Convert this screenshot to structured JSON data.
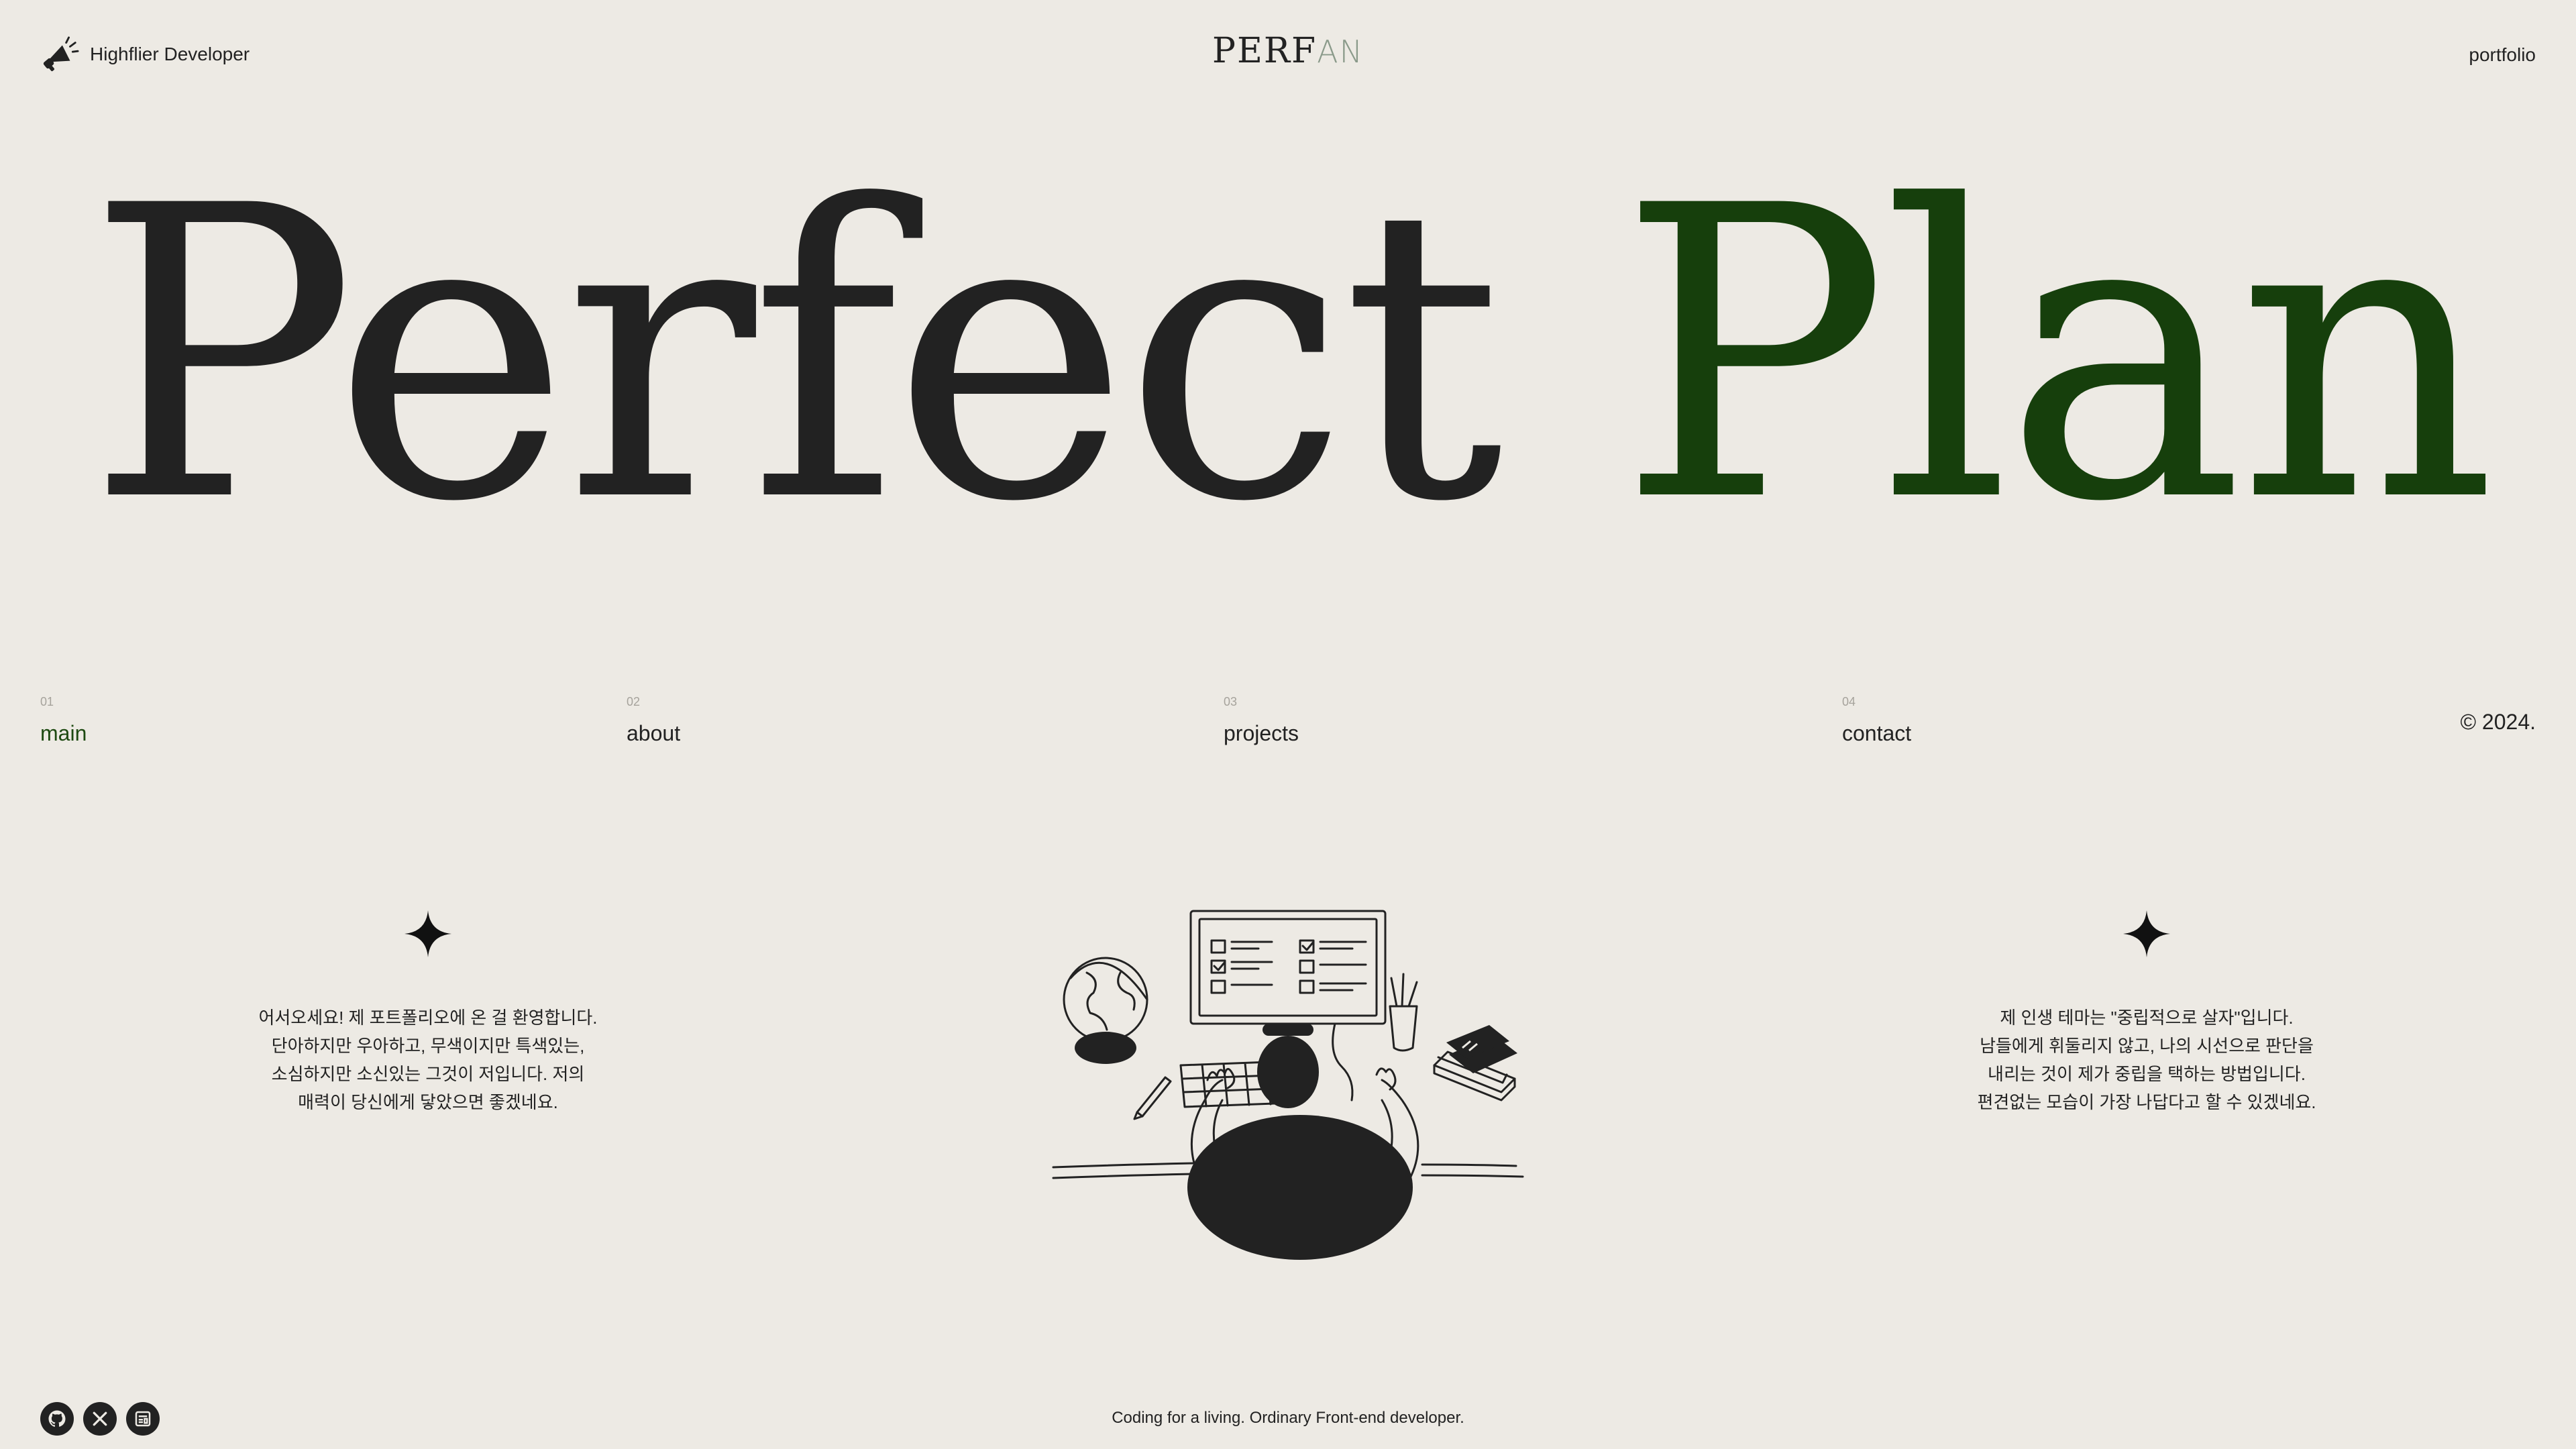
{
  "header": {
    "brand_label": "Highflier Developer",
    "brand_icon": "megaphone-icon",
    "logo_part1": "PERF",
    "logo_part2": "AN",
    "portfolio_link": "portfolio"
  },
  "hero": {
    "word1": "Perfect",
    "word2": "Plan",
    "accent_color": "#163f0c",
    "text_color": "#222222"
  },
  "nav": {
    "items": [
      {
        "number": "01",
        "label": "main",
        "active": true
      },
      {
        "number": "02",
        "label": "about",
        "active": false
      },
      {
        "number": "03",
        "label": "projects",
        "active": false
      },
      {
        "number": "04",
        "label": "contact",
        "active": false
      }
    ],
    "copyright": "© 2024."
  },
  "intro_left": {
    "icon": "sparkle-icon",
    "lines": [
      "어서오세요! 제 포트폴리오에 온 걸 환영합니다.",
      "단아하지만 우아하고, 무색이지만 특색있는,",
      "소심하지만 소신있는 그것이 저입니다. 저의",
      "매력이 당신에게 닿았으면 좋겠네요."
    ]
  },
  "intro_right": {
    "icon": "sparkle-icon",
    "lines": [
      "제 인생 테마는 \"중립적으로 살자\"입니다.",
      "남들에게 휘둘리지 않고, 나의 시선으로 판단을",
      "내리는 것이 제가 중립을 택하는 방법입니다.",
      "편견없는 모습이 가장 나답다고 할 수 있겠네요."
    ]
  },
  "illustration": {
    "icon": "developer-at-desk-illustration"
  },
  "footer": {
    "socials": [
      {
        "name": "github",
        "icon": "github-icon"
      },
      {
        "name": "x",
        "icon": "x-twitter-icon"
      },
      {
        "name": "blog",
        "icon": "blog-icon"
      }
    ],
    "tagline": "Coding for a living. Ordinary Front-end developer."
  }
}
